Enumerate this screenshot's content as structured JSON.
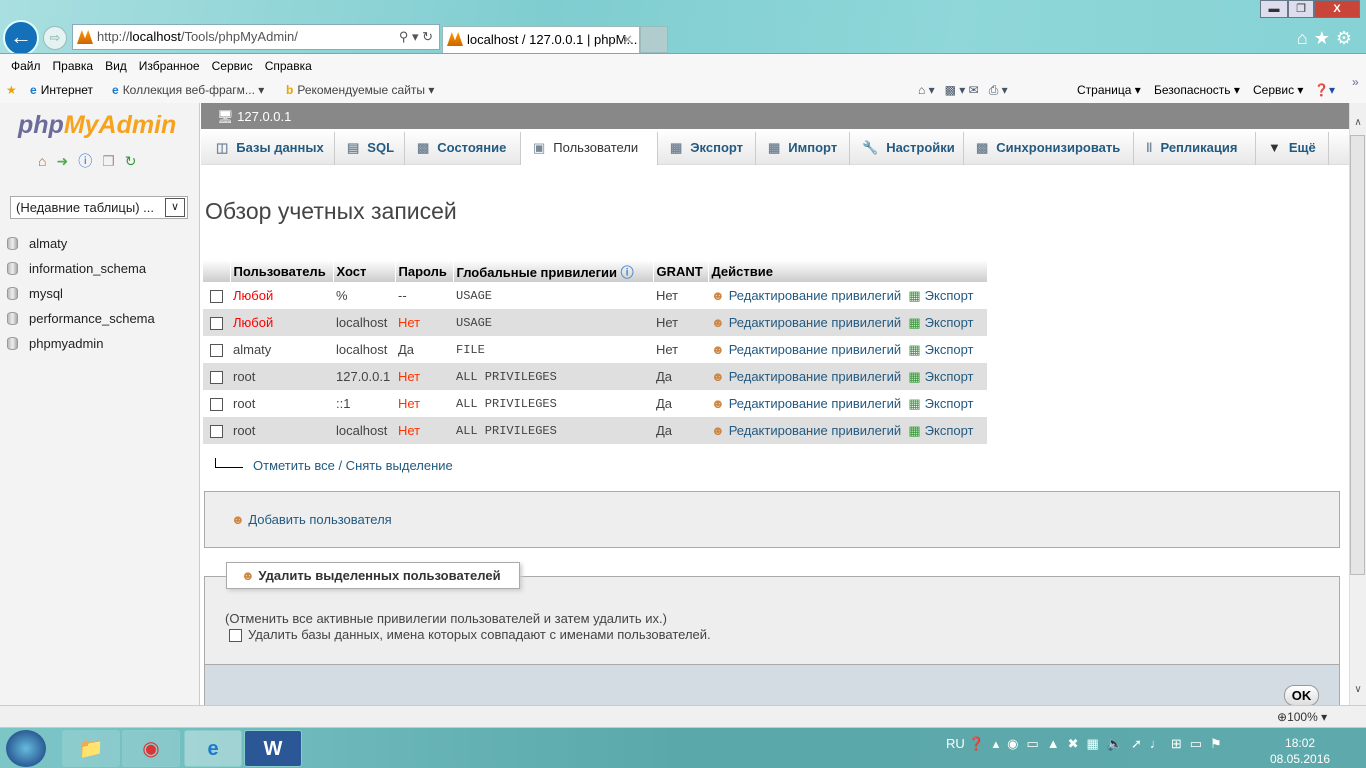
{
  "browser": {
    "url_prefix": "http://",
    "url_host": "localhost",
    "url_path": "/Tools/phpMyAdmin/",
    "tab_title": "localhost / 127.0.0.1 | phpM...",
    "menu": [
      "Файл",
      "Правка",
      "Вид",
      "Избранное",
      "Сервис",
      "Справка"
    ],
    "favorites": [
      "Интернет",
      "Коллекция веб-фрагм...",
      "Рекомендуемые сайты"
    ],
    "command_bar": [
      "Страница",
      "Безопасность",
      "Сервис"
    ],
    "zoom": "100%"
  },
  "sidebar": {
    "logo": "phpMyAdmin",
    "recent": "(Недавние таблицы) ...",
    "databases": [
      "almaty",
      "information_schema",
      "mysql",
      "performance_schema",
      "phpmyadmin"
    ]
  },
  "server": "127.0.0.1",
  "tabs": [
    "Базы данных",
    "SQL",
    "Состояние",
    "Пользователи",
    "Экспорт",
    "Импорт",
    "Настройки",
    "Синхронизировать",
    "Репликация",
    "Ещё"
  ],
  "page_title": "Обзор учетных записей",
  "table": {
    "headers": [
      "Пользователь",
      "Хост",
      "Пароль",
      "Глобальные привилегии",
      "GRANT",
      "Действие"
    ],
    "rows": [
      {
        "user": "Любой",
        "host": "%",
        "password": "--",
        "privs": "USAGE",
        "grant": "Нет"
      },
      {
        "user": "Любой",
        "host": "localhost",
        "password": "Нет",
        "privs": "USAGE",
        "grant": "Нет"
      },
      {
        "user": "almaty",
        "host": "localhost",
        "password": "Да",
        "privs": "FILE",
        "grant": "Нет"
      },
      {
        "user": "root",
        "host": "127.0.0.1",
        "password": "Нет",
        "privs": "ALL PRIVILEGES",
        "grant": "Да"
      },
      {
        "user": "root",
        "host": "::1",
        "password": "Нет",
        "privs": "ALL PRIVILEGES",
        "grant": "Да"
      },
      {
        "user": "root",
        "host": "localhost",
        "password": "Нет",
        "privs": "ALL PRIVILEGES",
        "grant": "Да"
      }
    ],
    "edit_label": "Редактирование привилегий",
    "export_label": "Экспорт"
  },
  "check_all": "Отметить все / Снять выделение",
  "add_user": "Добавить пользователя",
  "delete": {
    "legend": "Удалить выделенных пользователей",
    "note": "(Отменить все активные привилегии пользователей и затем удалить их.)",
    "drop_db": "Удалить базы данных, имена которых совпадают с именами пользователей.",
    "ok": "OK"
  },
  "taskbar": {
    "lang": "RU",
    "time": "18:02",
    "date": "08.05.2016"
  }
}
